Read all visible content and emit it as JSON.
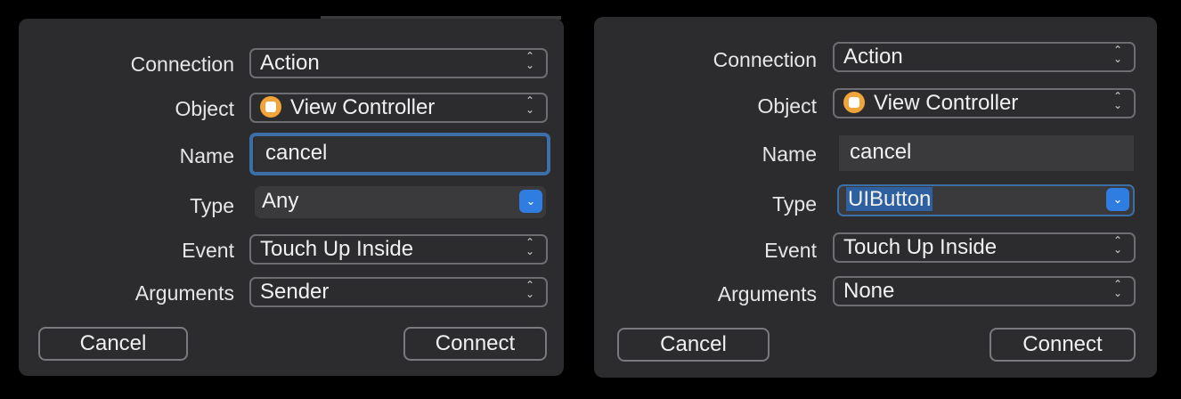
{
  "labels": {
    "connection": "Connection",
    "object": "Object",
    "name": "Name",
    "type": "Type",
    "event": "Event",
    "arguments": "Arguments"
  },
  "left": {
    "connection": "Action",
    "object": "View Controller",
    "name": "cancel",
    "type": "Any",
    "event": "Touch Up Inside",
    "arguments": "Sender",
    "cancel": "Cancel",
    "connect": "Connect"
  },
  "right": {
    "connection": "Action",
    "object": "View Controller",
    "name": "cancel",
    "type": "UIButton",
    "event": "Touch Up Inside",
    "arguments": "None",
    "cancel": "Cancel",
    "connect": "Connect"
  },
  "icons": {
    "popup": "up-down-chevron-icon",
    "type_dropdown": "chevron-down-icon",
    "object": "view-controller-icon"
  },
  "colors": {
    "panel": "#2c2c2e",
    "accent": "#2f7de1",
    "focus_ring": "#3c6fa8",
    "object_icon": "#f0a43a"
  }
}
